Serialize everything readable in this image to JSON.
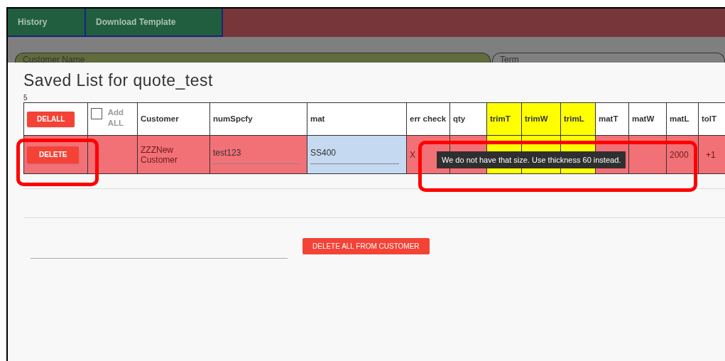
{
  "nav_tabs": [
    {
      "label": "History"
    },
    {
      "label": "Download Template"
    }
  ],
  "form_fields": [
    {
      "label": "Customer Name",
      "highlighted": true
    },
    {
      "label": "Term",
      "highlighted": false
    }
  ],
  "dialog": {
    "title": "Saved List for quote_test",
    "count": "5",
    "table": {
      "columns": [
        {
          "kind": "button",
          "label": "DELALL",
          "highlighted": false
        },
        {
          "kind": "checkbox",
          "label": "Add ALL",
          "checked": false,
          "highlighted": false
        },
        {
          "kind": "text",
          "label": "Customer",
          "highlighted": false
        },
        {
          "kind": "text",
          "label": "numSpcfy",
          "highlighted": false
        },
        {
          "kind": "text",
          "label": "mat",
          "highlighted": false
        },
        {
          "kind": "text",
          "label": "err check",
          "highlighted": false
        },
        {
          "kind": "text",
          "label": "qty",
          "highlighted": false
        },
        {
          "kind": "text",
          "label": "trimT",
          "highlighted": true
        },
        {
          "kind": "text",
          "label": "trimW",
          "highlighted": true
        },
        {
          "kind": "text",
          "label": "trimL",
          "highlighted": true
        },
        {
          "kind": "text",
          "label": "matT",
          "highlighted": false
        },
        {
          "kind": "text",
          "label": "matW",
          "highlighted": false
        },
        {
          "kind": "text",
          "label": "matL",
          "highlighted": false
        },
        {
          "kind": "text",
          "label": "tolT",
          "highlighted": false
        }
      ],
      "rows": [
        {
          "error": true,
          "cells": [
            {
              "kind": "button",
              "text": "DELETE"
            },
            {
              "kind": "blank"
            },
            {
              "kind": "text",
              "text": "ZZZNew Customer"
            },
            {
              "kind": "input",
              "text": "test123",
              "selected": false
            },
            {
              "kind": "input",
              "text": "SS400",
              "selected": true
            },
            {
              "kind": "text",
              "text": "X"
            },
            {
              "kind": "blank"
            },
            {
              "kind": "blank"
            },
            {
              "kind": "blank"
            },
            {
              "kind": "blank"
            },
            {
              "kind": "blank"
            },
            {
              "kind": "blank"
            },
            {
              "kind": "text",
              "text": "2000"
            },
            {
              "kind": "text",
              "text": "+1"
            }
          ]
        }
      ]
    },
    "tooltip": "We do not have that size. Use thickness 60 instead.",
    "delete_all_button": "DELETE ALL FROM CUSTOMER"
  }
}
